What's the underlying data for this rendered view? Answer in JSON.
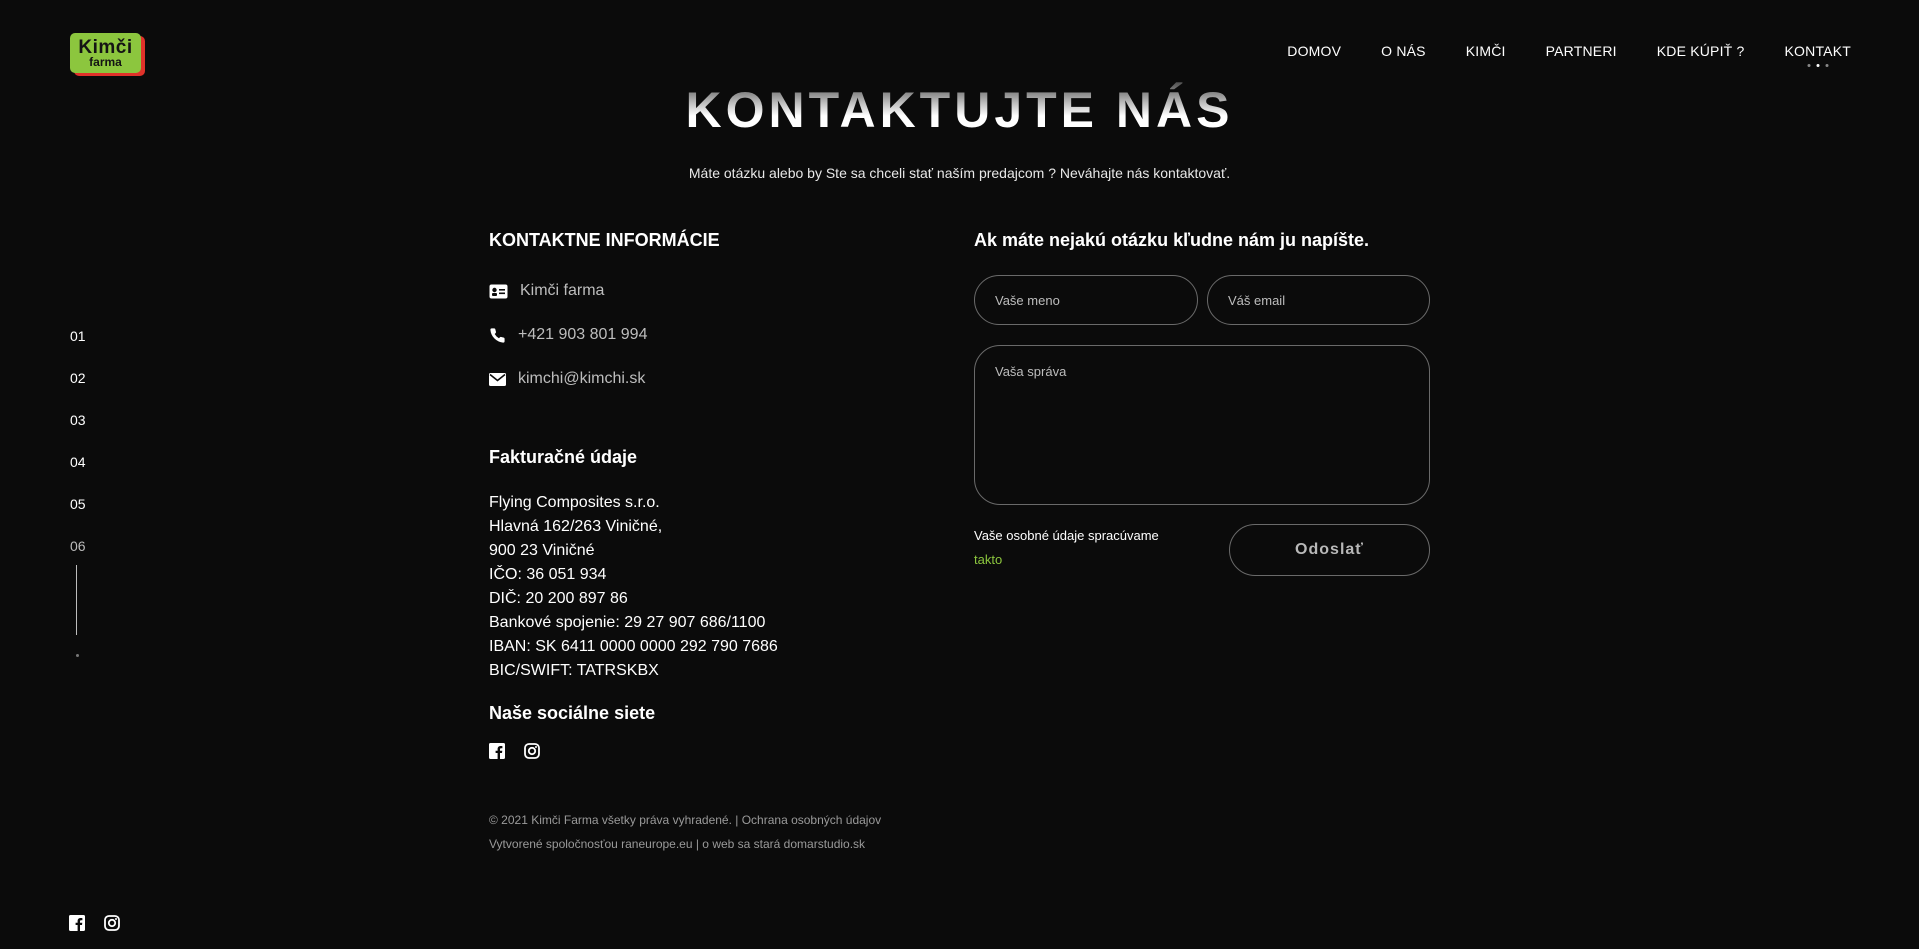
{
  "brand": {
    "logo_line1": "Kimči",
    "logo_line2": "farma",
    "colors": {
      "green": "#8cc63e",
      "red": "#e0322a",
      "background": "#0b0b0b"
    }
  },
  "nav": {
    "items": [
      {
        "label": "DOMOV"
      },
      {
        "label": "O NÁS"
      },
      {
        "label": "KIMČI"
      },
      {
        "label": "PARTNERI"
      },
      {
        "label": "KDE KÚPIŤ ?"
      },
      {
        "label": "KONTAKT",
        "active": true
      }
    ]
  },
  "section_nav": {
    "items": [
      "01",
      "02",
      "03",
      "04",
      "05",
      "06"
    ],
    "current": "06"
  },
  "hero": {
    "title": "KONTAKTUJTE NÁS",
    "subtitle": "Máte otázku alebo by Ste sa chceli stať naším predajcom ? Neváhajte nás kontaktovať."
  },
  "contact_info": {
    "heading": "KONTAKTNE INFORMÁCIE",
    "rows": [
      {
        "icon": "id-card-icon",
        "text": "Kimči farma"
      },
      {
        "icon": "phone-icon",
        "text": "+421 903 801 994"
      },
      {
        "icon": "envelope-icon",
        "text": "kimchi@kimchi.sk"
      }
    ]
  },
  "billing": {
    "heading": "Fakturačné údaje",
    "lines": [
      "Flying Composites s.r.o.",
      "Hlavná 162/263 Viničné,",
      "900 23 Viničné",
      "IČO: 36 051 934",
      "DIČ: 20 200 897 86",
      "Bankové spojenie: 29 27 907 686/1100",
      "IBAN: SK 6411 0000 0000 292 790 7686",
      "BIC/SWIFT: TATRSKBX"
    ]
  },
  "social": {
    "heading": "Naše sociálne siete",
    "icons": [
      "facebook-icon",
      "instagram-icon"
    ]
  },
  "footer": {
    "line1": "© 2021 Kimči Farma všetky práva vyhradené. | Ochrana osobných údajov",
    "line2": "Vytvorené spoločnosťou raneurope.eu | o web sa stará domarstudio.sk"
  },
  "form": {
    "heading": "Ak máte nejakú otázku kľudne nám ju napíšte.",
    "name_placeholder": "Vaše meno",
    "email_placeholder": "Váš email",
    "message_placeholder": "Vaša správa",
    "consent_text": "Vaše osobné údaje spracúvame",
    "consent_link": "takto",
    "submit_label": "Odoslať"
  }
}
